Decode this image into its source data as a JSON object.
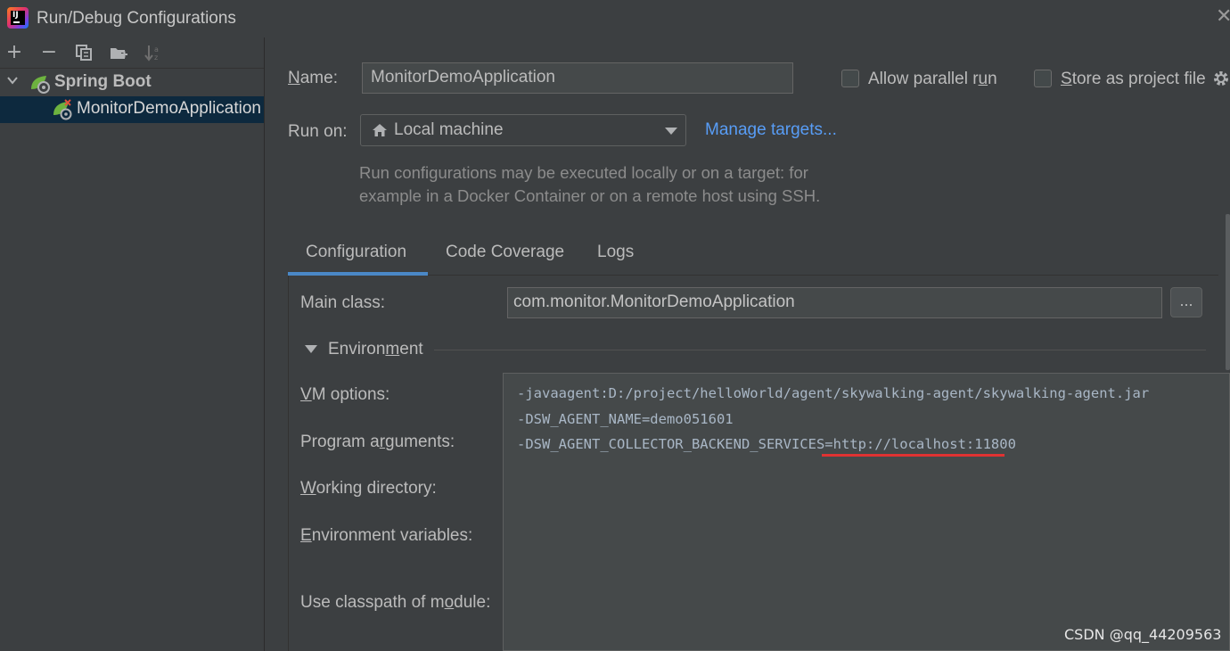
{
  "window": {
    "title": "Run/Debug Configurations",
    "close": "✕"
  },
  "toolbar": {
    "add": "+",
    "remove": "−"
  },
  "tree": {
    "group_label": "Spring Boot",
    "item_label": "MonitorDemoApplication"
  },
  "form": {
    "name_label": "Name:",
    "name_value": "MonitorDemoApplication",
    "allow_parallel_label": "Allow parallel run",
    "store_project_label": "Store as project file",
    "run_on_label": "Run on:",
    "run_on_value": "Local machine",
    "manage_targets": "Manage targets...",
    "help_line1": "Run configurations may be executed locally or on a target: for",
    "help_line2": "example in a Docker Container or on a remote host using SSH."
  },
  "tabs": [
    "Configuration",
    "Code Coverage",
    "Logs"
  ],
  "configuration": {
    "main_class_label": "Main class:",
    "main_class_value": "com.monitor.MonitorDemoApplication",
    "browse_label": "...",
    "environment_label": "Environment",
    "vm_options_label": "VM options:",
    "program_args_label": "Program arguments:",
    "working_dir_label": "Working directory:",
    "env_vars_label": "Environment variables:",
    "classpath_label": "Use classpath of module:",
    "vm_options_lines": [
      "-javaagent:D:/project/helloWorld/agent/skywalking-agent/skywalking-agent.jar",
      "-DSW_AGENT_NAME=demo051601",
      "-DSW_AGENT_COLLECTOR_BACKEND_SERVICES=http://localhost:11800"
    ]
  },
  "watermark": "CSDN @qq_44209563",
  "colors": {
    "background": "#3c3f41",
    "selection": "#0d293e",
    "link": "#589df6",
    "tab_underline": "#4a88c7",
    "highlight": "#e03232"
  }
}
